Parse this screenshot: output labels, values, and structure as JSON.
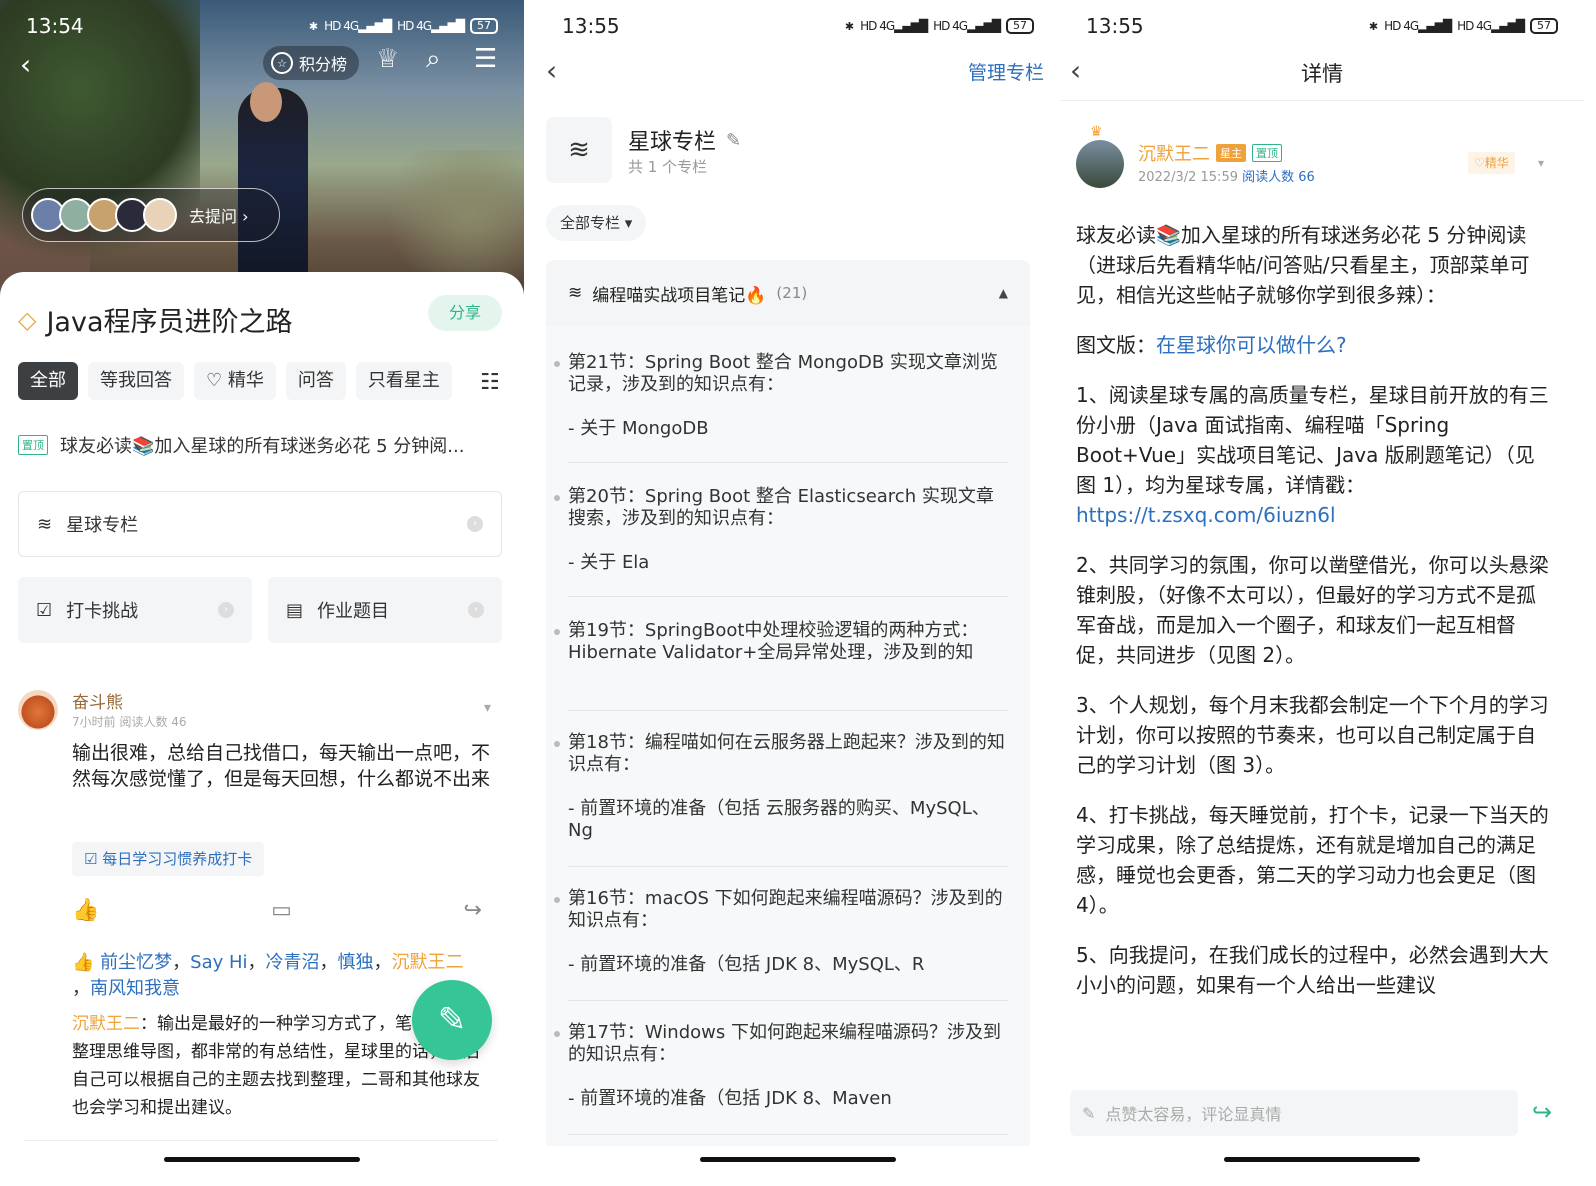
{
  "screen1": {
    "status": {
      "time": "13:54",
      "battery": "57"
    },
    "hero": {
      "score_label": "积分榜",
      "ask_label": "去提问 ›"
    },
    "group_name": "Java程序员进阶之路",
    "share_label": "分享",
    "tabs": [
      "全部",
      "等我回答",
      "♡ 精华",
      "问答",
      "只看星主"
    ],
    "pinned": {
      "tag": "置顶",
      "text": "球友必读📚加入星球的所有球迷务必花 5 分钟阅..."
    },
    "column_entry": "星球专栏",
    "checkin_entry": "打卡挑战",
    "homework_entry": "作业题目",
    "post": {
      "author": "奋斗熊",
      "meta": "7小时前  阅读人数 46",
      "body": "输出很难，总给自己找借口，每天输出一点吧，不然每次感觉懂了，但是每天回想，什么都说不出来",
      "tag": "每日学习习惯养成打卡",
      "likers_prefix": "👍 ",
      "likers": [
        "前尘忆梦",
        "Say Hi",
        "冷青沼",
        "慎独"
      ],
      "liker_highlight": "沉默王二",
      "liker_last": "南风知我意",
      "reply_author": "沉默王二",
      "reply_text": "：输出是最好的一种学习方式了，笔记，还是整理思维导图，都非常的有总结性，星球里的话，以后自己可以根据自己的主题去找到整理，二哥和其他球友也会学习和提出建议。"
    }
  },
  "screen2": {
    "status": {
      "time": "13:55",
      "battery": "57"
    },
    "manage_label": "管理专栏",
    "column_title": "星球专栏",
    "column_sub": "共 1 个专栏",
    "filter_label": "全部专栏 ▾",
    "section_title": "编程喵实战项目笔记🔥",
    "section_count": "(21)",
    "items": [
      {
        "title": "第21节：Spring Boot 整合 MongoDB 实现文章浏览记录，涉及到的知识点有：",
        "sub": "- 关于 MongoDB"
      },
      {
        "title": "第20节：Spring Boot 整合 Elasticsearch 实现文章搜索，涉及到的知识点有：",
        "sub": "- 关于 Ela"
      },
      {
        "title": "第19节：SpringBoot中处理校验逻辑的两种方式：Hibernate Validator+全局异常处理，涉及到的知",
        "sub": ""
      },
      {
        "title": "第18节：编程喵如何在云服务器上跑起来？涉及到的知识点有：",
        "sub": "- 前置环境的准备（包括 云服务器的购买、MySQL、Ng"
      },
      {
        "title": "第16节：macOS 下如何跑起来编程喵源码？涉及到的知识点有：",
        "sub": "- 前置环境的准备（包括 JDK 8、MySQL、R"
      },
      {
        "title": "第17节：Windows 下如何跑起来编程喵源码？涉及到的知识点有：",
        "sub": "- 前置环境的准备（包括 JDK 8、Maven"
      }
    ]
  },
  "screen3": {
    "status": {
      "time": "13:55",
      "battery": "57"
    },
    "title": "详情",
    "author": "沉默王二",
    "badge_owner": "星主",
    "badge_pin": "置顶",
    "date": "2022/3/2 15:59",
    "reads": "阅读人数 66",
    "essence": "♡精华",
    "p1": "球友必读📚加入星球的所有球迷务必花 5 分钟阅读（进球后先看精华帖/问答贴/只看星主，顶部菜单可见，相信光这些帖子就够你学到很多辣）：",
    "p2_prefix": "图文版：",
    "p2_link": "在星球你可以做什么?",
    "p3": "1、阅读星球专属的高质量专栏，星球目前开放的有三份小册（Java 面试指南、编程喵「Spring Boot+Vue」实战项目笔记、Java 版刷题笔记）（见图 1），均为星球专属，详情戳：",
    "p3_link": "https://t.zsxq.com/6iuzn6l",
    "p4": "2、共同学习的氛围，你可以凿壁借光，你可以头悬梁锥刺股，（好像不太可以），但最好的学习方式不是孤军奋战，而是加入一个圈子，和球友们一起互相督促，共同进步（见图 2）。",
    "p5": "3、个人规划，每个月末我都会制定一个下个月的学习计划，你可以按照的节奏来，也可以自己制定属于自己的学习计划（图 3）。",
    "p6": "4、打卡挑战，每天睡觉前，打个卡，记录一下当天的学习成果，除了总结提炼，还有就是增加自己的满足感，睡觉也会更香，第二天的学习动力也会更足（图 4）。",
    "p7": "5、向我提问，在我们成长的过程中，必然会遇到大大小小的问题，如果有一个人给出一些建议",
    "comment_placeholder": "点赞太容易，评论显真情"
  }
}
